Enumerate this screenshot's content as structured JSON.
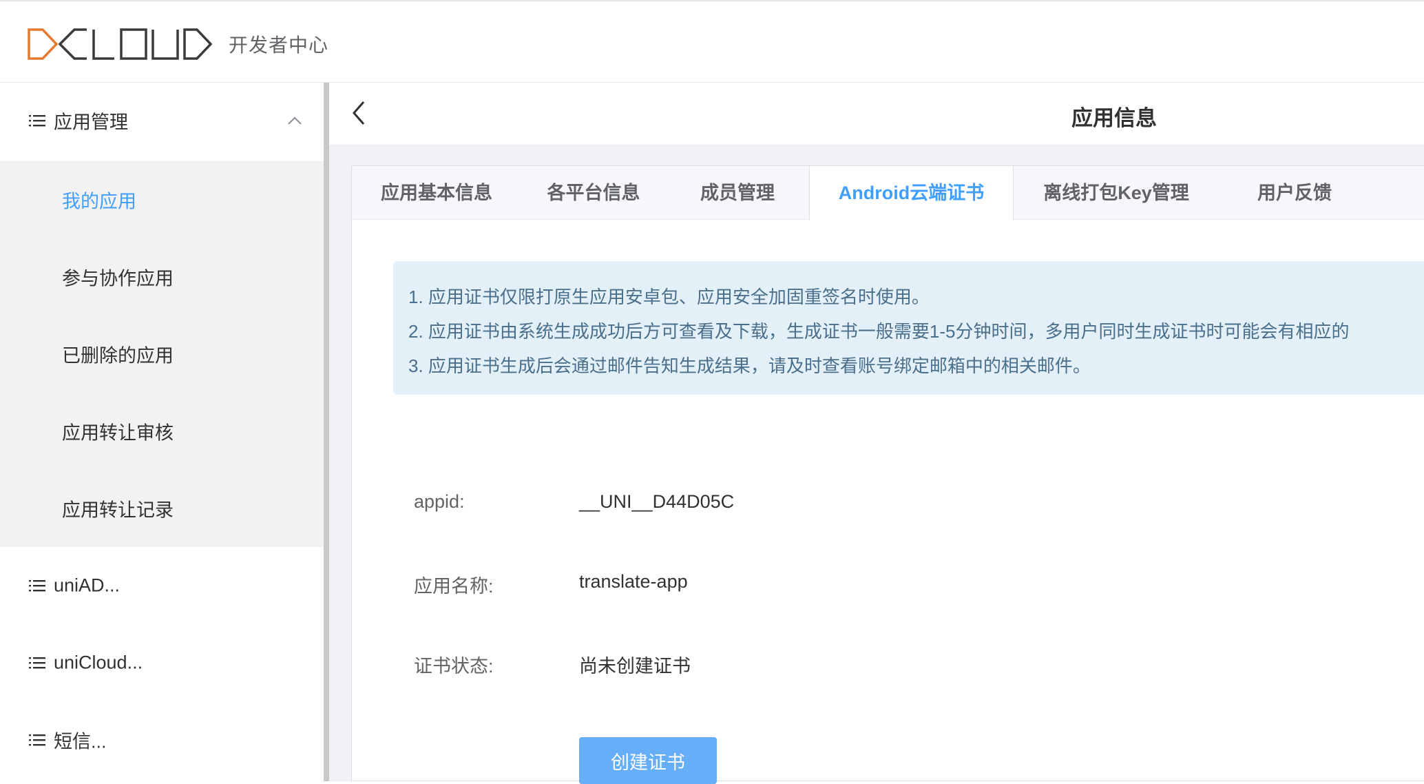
{
  "brand": {
    "logo_text": "DCLOUD",
    "subtitle": "开发者中心",
    "accent_orange": "#e67a2e",
    "logo_gray": "#303133"
  },
  "sidebar": {
    "group_app": {
      "label": "应用管理",
      "icon": "list-icon",
      "expanded": true,
      "chevron": "chevron-up-icon"
    },
    "items": [
      {
        "label": "我的应用",
        "active": true
      },
      {
        "label": "参与协作应用"
      },
      {
        "label": "已删除的应用"
      },
      {
        "label": "应用转让审核"
      },
      {
        "label": "应用转让记录"
      }
    ],
    "group_uniad": {
      "label": "uniAD...",
      "icon": "list-icon"
    },
    "group_unicloud": {
      "label": "uniCloud...",
      "icon": "list-icon"
    },
    "group_sms": {
      "label": "短信...",
      "icon": "list-icon"
    }
  },
  "header": {
    "title": "应用信息",
    "back_icon": "chevron-left-icon"
  },
  "tabs": [
    {
      "label": "应用基本信息"
    },
    {
      "label": "各平台信息"
    },
    {
      "label": "成员管理"
    },
    {
      "label": "Android云端证书",
      "active": true
    },
    {
      "label": "离线打包Key管理"
    },
    {
      "label": "用户反馈"
    }
  ],
  "notice": {
    "lines": [
      "1. 应用证书仅限打原生应用安卓包、应用安全加固重签名时使用。",
      "2. 应用证书由系统生成成功后方可查看及下载，生成证书一般需要1-5分钟时间，多用户同时生成证书时可能会有相应的",
      "3. 应用证书生成后会通过邮件告知生成结果，请及时查看账号绑定邮箱中的相关邮件。"
    ]
  },
  "info": {
    "appid_label": "appid:",
    "appid_value": "__UNI__D44D05C",
    "name_label": "应用名称:",
    "name_value": "translate-app",
    "status_label": "证书状态:",
    "status_value": "尚未创建证书"
  },
  "actions": {
    "create_label": "创建证书",
    "primary_color": "#409eff"
  }
}
